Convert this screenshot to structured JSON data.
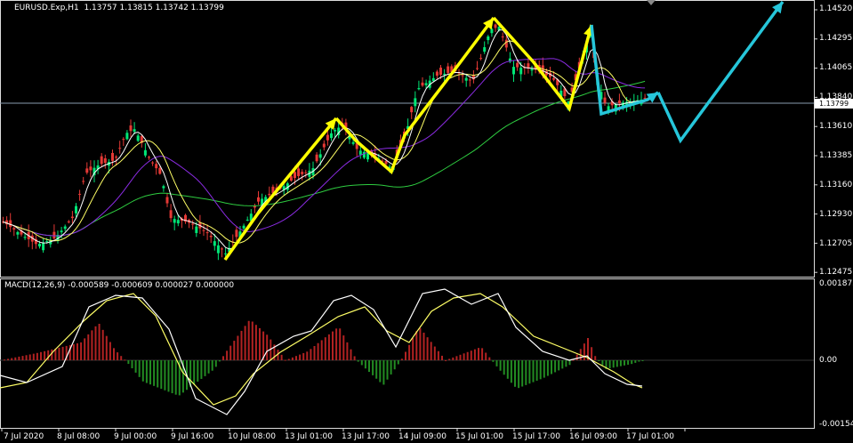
{
  "main_header": {
    "symbol_tf": "EURUSD.Exp,H1",
    "ohlc": "1.13757 1.13815 1.13742 1.13799"
  },
  "price_axis": [
    "1.14520",
    "1.14295",
    "1.14065",
    "1.13840",
    "1.13610",
    "1.13385",
    "1.13160",
    "1.12930",
    "1.12705",
    "1.12475"
  ],
  "current_price": "1.13799",
  "macd_header": "MACD(12,26,9) -0.000589 -0.000609 0.000027 0.000000",
  "macd_axis": {
    "top": "0.001873",
    "zero": "0.00",
    "bottom": "-0.001542"
  },
  "time_axis": [
    "7 Jul 2020",
    "8 Jul 08:00",
    "9 Jul 00:00",
    "9 Jul 16:00",
    "10 Jul 08:00",
    "13 Jul 01:00",
    "13 Jul 17:00",
    "14 Jul 09:00",
    "15 Jul 01:00",
    "15 Jul 17:00",
    "16 Jul 09:00",
    "17 Jul 01:00"
  ],
  "colors": {
    "bull": "#00e676",
    "bear": "#e53935",
    "ma_fast": "#ffffff",
    "ma_mid": "#ffff66",
    "ma_slow": "#8a2be2",
    "ma_long": "#2ecc40",
    "wave_yellow": "#ffff00",
    "wave_cyan": "#26c6da",
    "hist_pos": "#b22222",
    "hist_neg": "#228b22"
  }
}
